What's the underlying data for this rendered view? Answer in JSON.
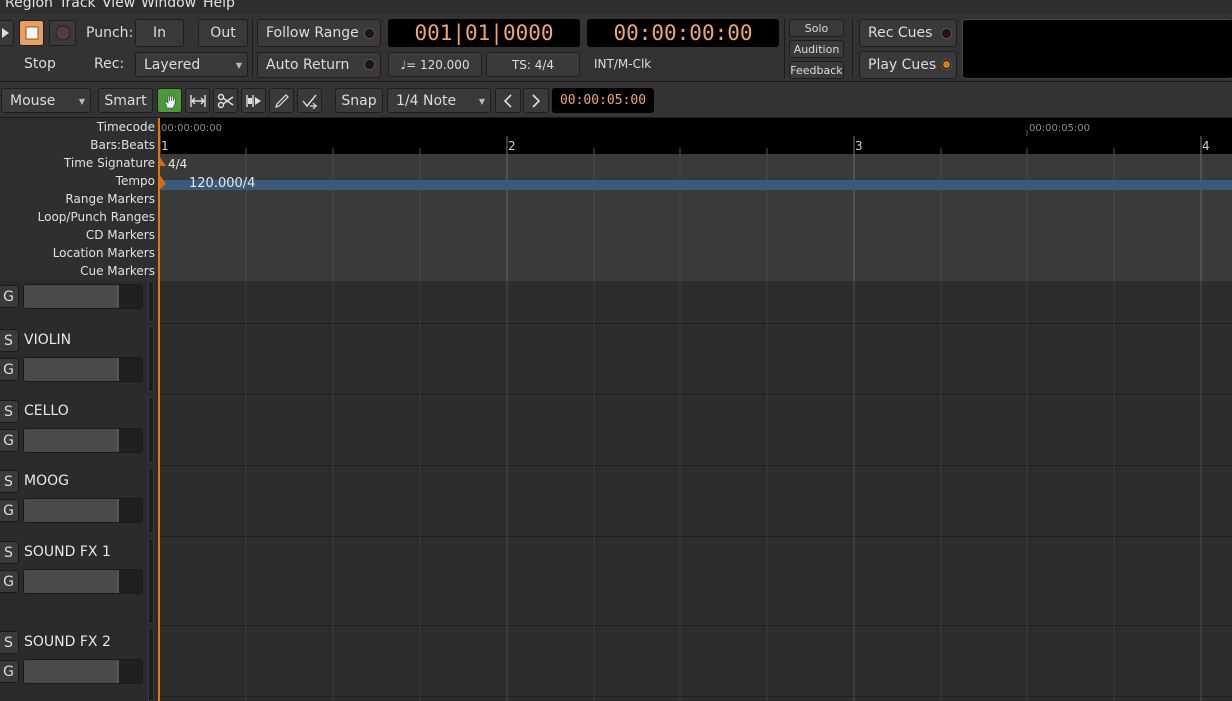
{
  "menu": [
    "Region",
    "Track",
    "View",
    "Window",
    "Help"
  ],
  "transport": {
    "stop_label": "Stop",
    "punch_label": "Punch:",
    "punch_in": "In",
    "punch_out": "Out",
    "rec_label": "Rec:",
    "rec_mode": "Layered",
    "follow_range": "Follow Range",
    "auto_return": "Auto Return",
    "bbt_clock": "001|01|0000",
    "timecode_clock": "00:00:00:00",
    "tempo": "♩= 120.000",
    "time_signature": "TS: 4/4",
    "sync_source": "INT/M-Clk",
    "solo": "Solo",
    "audition": "Audition",
    "feedback": "Feedback",
    "rec_cues": "Rec Cues",
    "play_cues": "Play Cues"
  },
  "toolbar": {
    "edit_point": "Mouse",
    "smart": "Smart",
    "snap": "Snap",
    "grid": "1/4 Note",
    "nudge_clock": "00:00:05:00"
  },
  "rulers": {
    "names": [
      "Timecode",
      "Bars:Beats",
      "Time Signature",
      "Tempo",
      "Range Markers",
      "Loop/Punch Ranges",
      "CD Markers",
      "Location Markers",
      "Cue Markers"
    ],
    "timecode_marks": [
      "00:00:00:00",
      "00:00:05:00"
    ],
    "bars": [
      "1",
      "2",
      "3",
      "4"
    ],
    "meter": "4/4",
    "tempo_value": "120.000/4"
  },
  "tracks": [
    {
      "name": ""
    },
    {
      "name": "VIOLIN"
    },
    {
      "name": "CELLO"
    },
    {
      "name": "MOOG"
    },
    {
      "name": "SOUND FX 1"
    },
    {
      "name": "SOUND FX 2"
    }
  ],
  "track_buttons": {
    "solo": "S",
    "group": "G"
  },
  "colors": {
    "accent_orange": "#e07a10",
    "active_tool_green": "#4a9a3a",
    "clock_text": "#f0a66a",
    "tempo_bar": "#3a5a7a"
  }
}
